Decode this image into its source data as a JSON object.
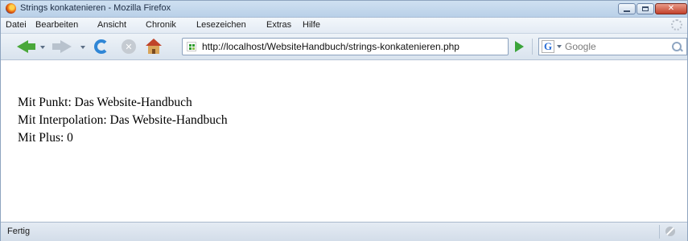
{
  "window": {
    "title": "Strings konkatenieren - Mozilla Firefox"
  },
  "menu": {
    "items": [
      "Datei",
      "Bearbeiten",
      "Ansicht",
      "Chronik",
      "Lesezeichen",
      "Extras",
      "Hilfe"
    ]
  },
  "toolbar": {
    "icons": [
      "back-icon",
      "forward-icon",
      "reload-icon",
      "stop-icon",
      "home-icon",
      "go-icon"
    ]
  },
  "address_bar": {
    "url": "http://localhost/WebsiteHandbuch/strings-konkatenieren.php"
  },
  "search": {
    "engine_icon": "G",
    "placeholder": "Google"
  },
  "page": {
    "lines": [
      "Mit Punkt: Das Website-Handbuch",
      "Mit Interpolation: Das Website-Handbuch",
      "Mit Plus: 0"
    ]
  },
  "status": {
    "text": "Fertig"
  },
  "colors": {
    "back_arrow": "#4aa83a",
    "reload": "#2f86d6",
    "close_button": "#c2412b"
  }
}
